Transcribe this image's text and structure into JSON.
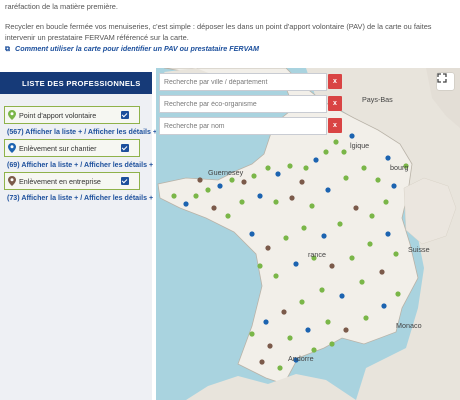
{
  "intro": {
    "line_top": "raréfaction de la matière première.",
    "paragraph": "Recycler en boucle fermée vos menuiseries, c'est simple : déposer les dans un point d'apport volontaire (PAV) de la carte ou faites intervenir un prestataire FERVAM référencé sur la carte.",
    "guide_link": "Comment utiliser la carte pour identifier un PAV ou prestataire FERVAM"
  },
  "sidebar": {
    "header": "LISTE DES PROFESSIONNELS",
    "categories": [
      {
        "label": "Point d'apport volontaire",
        "checked": true,
        "pin_color": "#7ab648",
        "links": "(567) Afficher la liste + / Afficher les détails +"
      },
      {
        "label": "Enlèvement sur chantier",
        "checked": true,
        "pin_color": "#1c63b0",
        "links": "(69) Afficher la liste + / Afficher les détails +"
      },
      {
        "label": "Enlèvement en entreprise",
        "checked": true,
        "pin_color": "#7b5a4a",
        "links": "(73) Afficher la liste + / Afficher les détails +"
      }
    ]
  },
  "search": {
    "city_placeholder": "Recherche par ville / département",
    "eco_placeholder": "Recherche par éco-organisme",
    "name_placeholder": "Recherche par nom",
    "clear_label": "x"
  },
  "map": {
    "labels": {
      "pays_bas": "Pays-Bas",
      "belgique": "lgique",
      "guernesey": "Guernesey",
      "luxembourg": "bourg",
      "suisse": "Suisse",
      "france": "rance",
      "monaco": "Monaco",
      "andorre": "Andorre"
    },
    "colors": {
      "sea": "#a9d3df",
      "land": "#e8e4dc",
      "france": "#f2efe9",
      "pav": "#7ab648",
      "chantier": "#1c63b0",
      "entreprise": "#7b5a4a"
    }
  }
}
